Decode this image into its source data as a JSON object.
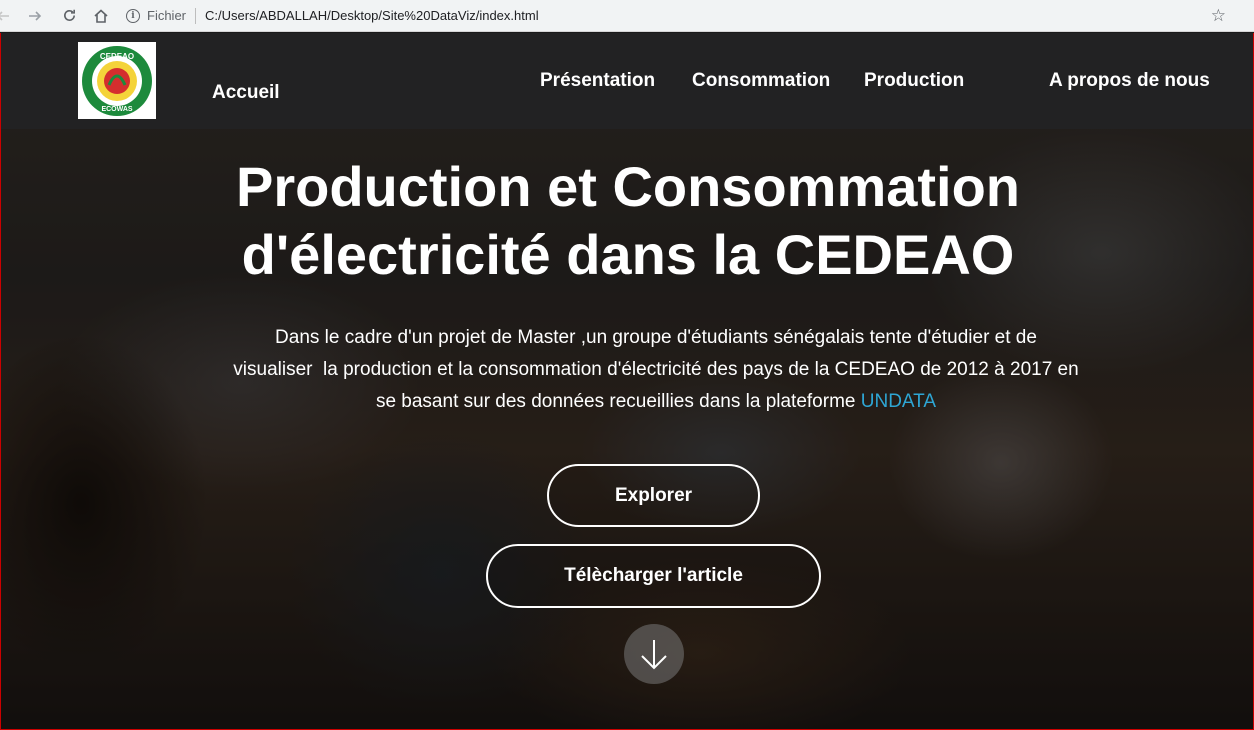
{
  "browser": {
    "scheme_label": "Fichier",
    "url": "C:/Users/ABDALLAH/Desktop/Site%20DataViz/index.html"
  },
  "logo": {
    "top_text": "CEDEAO",
    "bottom_text": "ECOWAS"
  },
  "nav": {
    "home": "Accueil",
    "items": [
      "Présentation",
      "Consommation",
      "Production",
      "A propos de nous"
    ]
  },
  "hero": {
    "title_line1": "Production et Consommation",
    "title_line2": "d'électricité dans la CEDEAO",
    "description_line1": "Dans le cadre d'un projet de Master ,un groupe d'étudiants sénégalais tente d'étudier et de",
    "description_line2": "visualiser  la production et la consommation d'électricité des pays de la CEDEAO de 2012 à 2017 en",
    "description_line3_prefix": "se basant sur des données recueillies dans la plateforme ",
    "description_link": "UNDATA",
    "buttons": {
      "explore": "Explorer",
      "download": "Télècharger l'article"
    }
  },
  "colors": {
    "navbar": "#222223",
    "link_accent": "#2ea6d4",
    "logo_green": "#1d8a3c",
    "logo_red": "#d42e2e"
  },
  "icons": {
    "back": "arrow-left-icon",
    "forward": "arrow-right-icon",
    "reload": "reload-icon",
    "home": "home-icon",
    "info": "info-icon",
    "bookmark": "star-icon",
    "scroll": "arrow-down-icon"
  }
}
